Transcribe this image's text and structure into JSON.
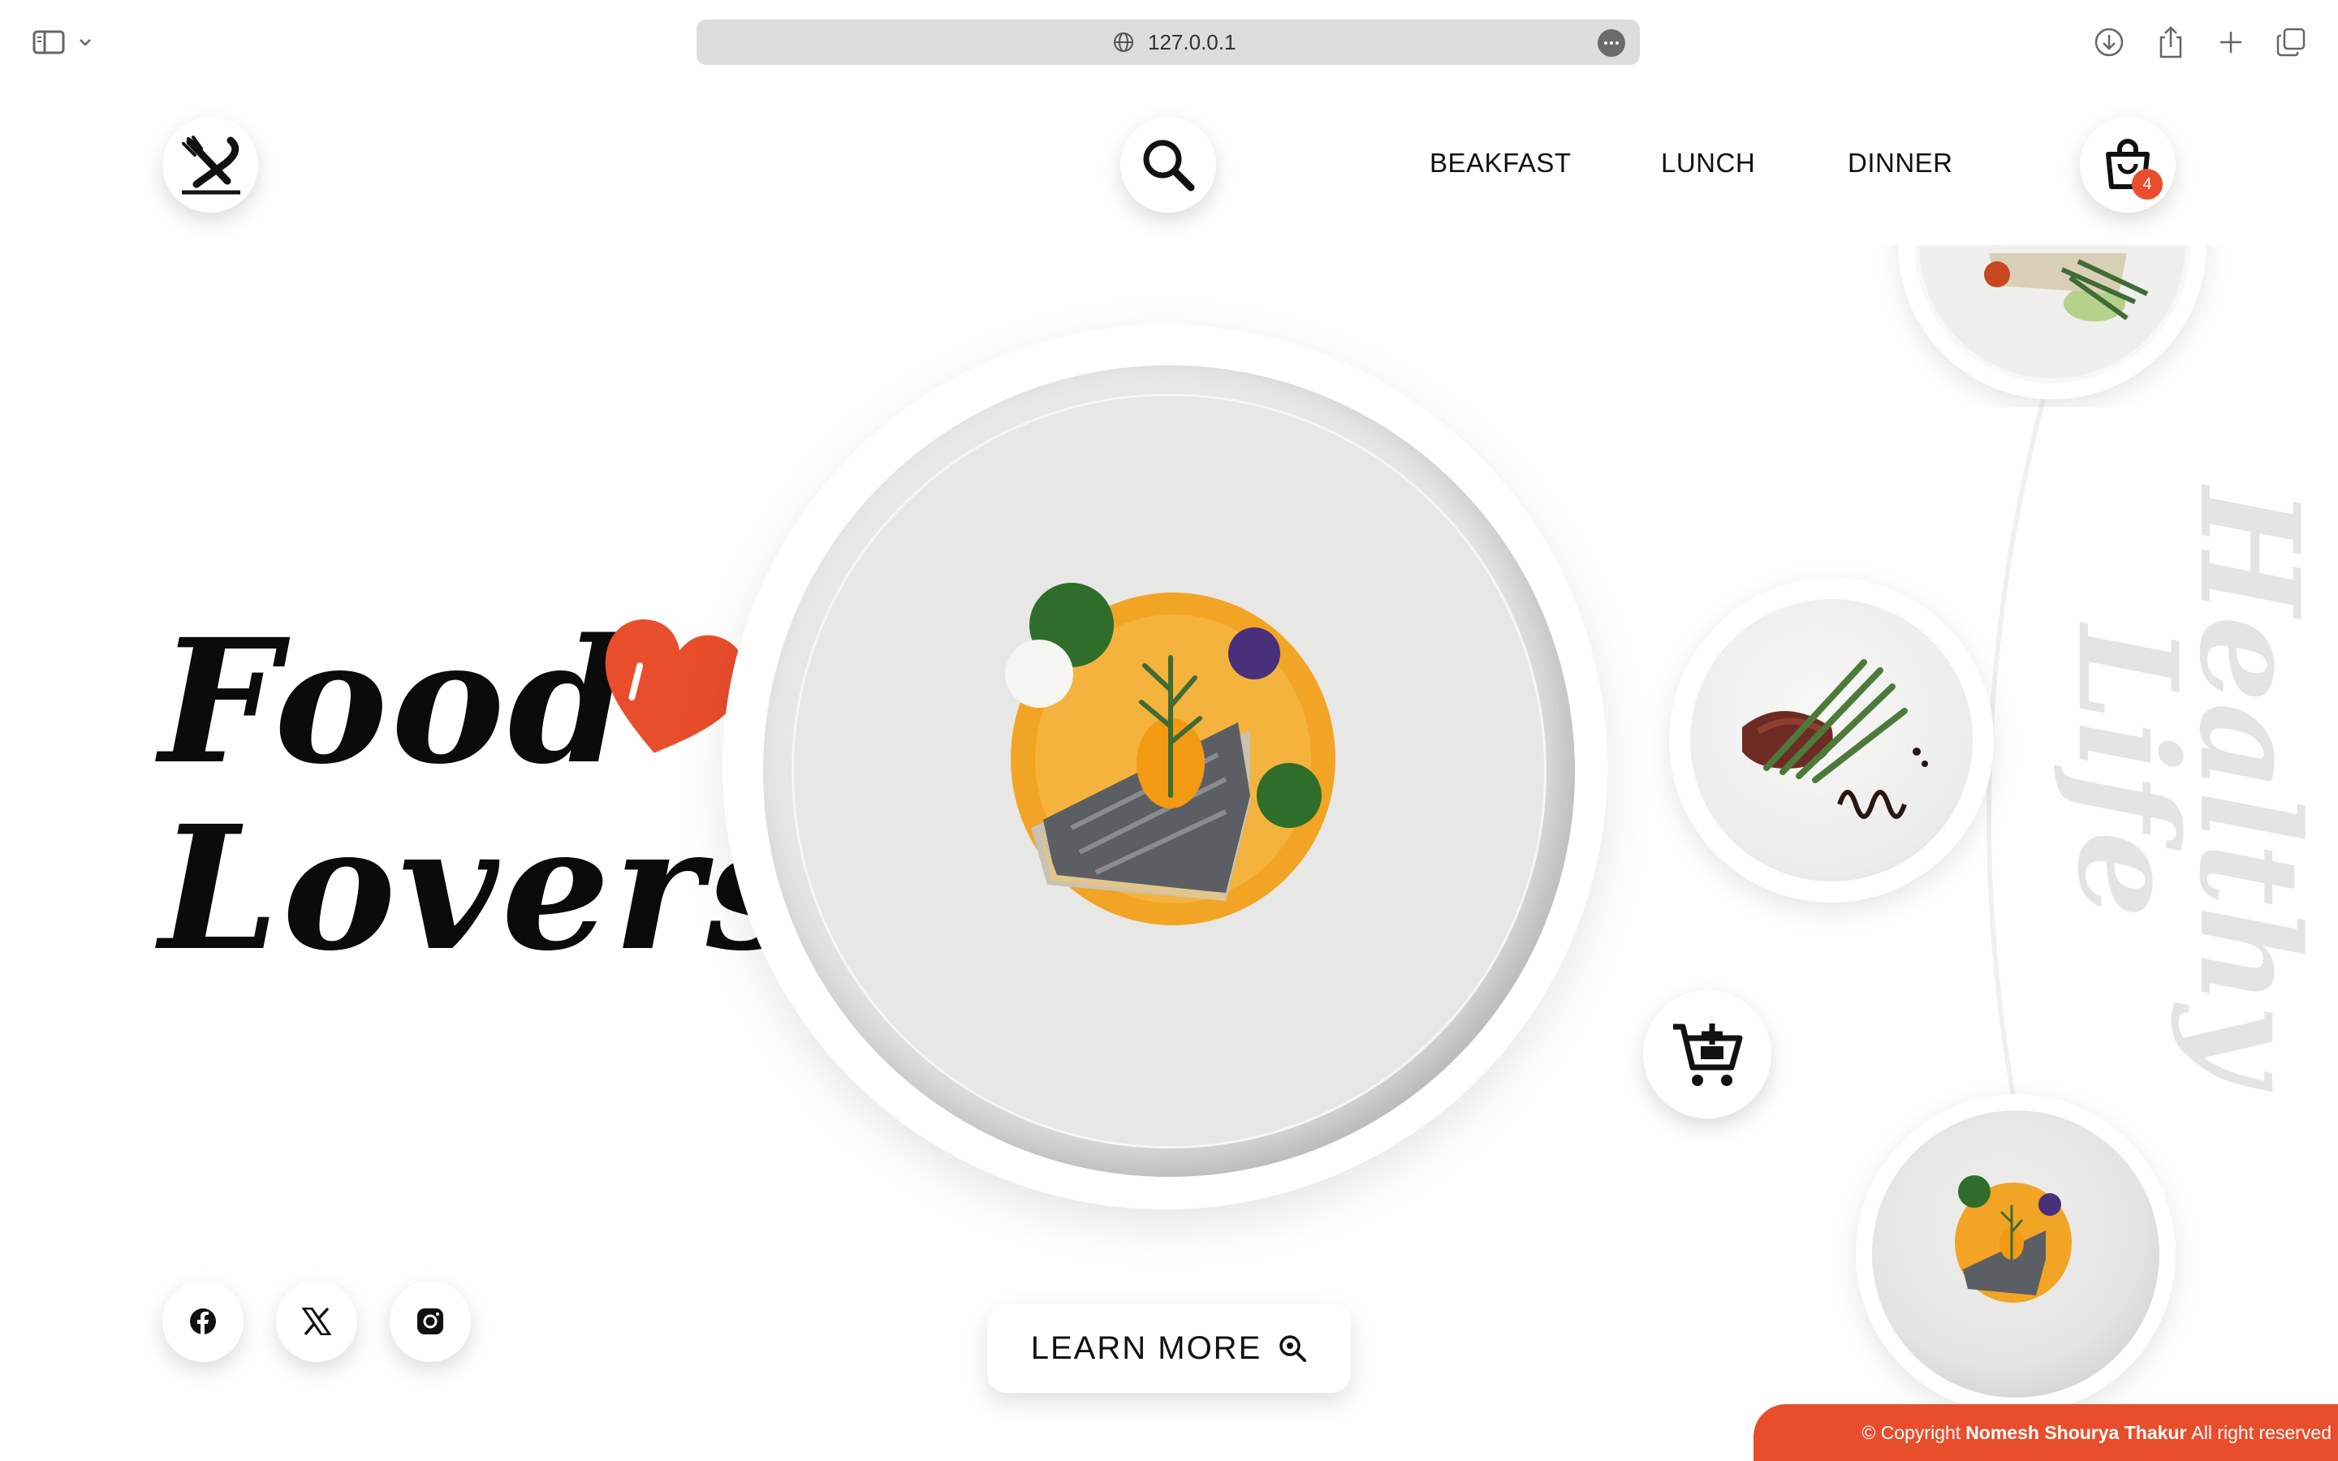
{
  "browser": {
    "url": "127.0.0.1",
    "icons": [
      "sidebar-icon",
      "chevron-down-icon",
      "globe-icon",
      "more-icon",
      "download-icon",
      "share-icon",
      "new-tab-icon",
      "tabs-overview-icon"
    ]
  },
  "nav": {
    "logo_icon": "fork-knife-icon",
    "search_icon": "search-icon",
    "links": [
      "BEAKFAST",
      "LUNCH",
      "DINNER"
    ],
    "cart_icon": "shopping-bag-icon",
    "cart_count": "4"
  },
  "hero": {
    "line1": "Food",
    "line2": "Lovers",
    "heart_icon": "heart-icon"
  },
  "side": {
    "vertical_title_1": "Healthy",
    "vertical_title_2": "Life",
    "add_cart_icon": "cart-plus-icon"
  },
  "learn_more": {
    "label": "LEARN MORE",
    "icon": "zoom-icon"
  },
  "social": [
    "facebook-icon",
    "x-icon",
    "instagram-icon"
  ],
  "footer": {
    "prefix": "© Copyright",
    "name": "Nomesh Shourya Thakur",
    "suffix": "All right reserved"
  },
  "colors": {
    "accent": "#e94e2c",
    "text": "#111111",
    "watermark": "#e4e4e4",
    "address_bar": "#dddddd"
  }
}
